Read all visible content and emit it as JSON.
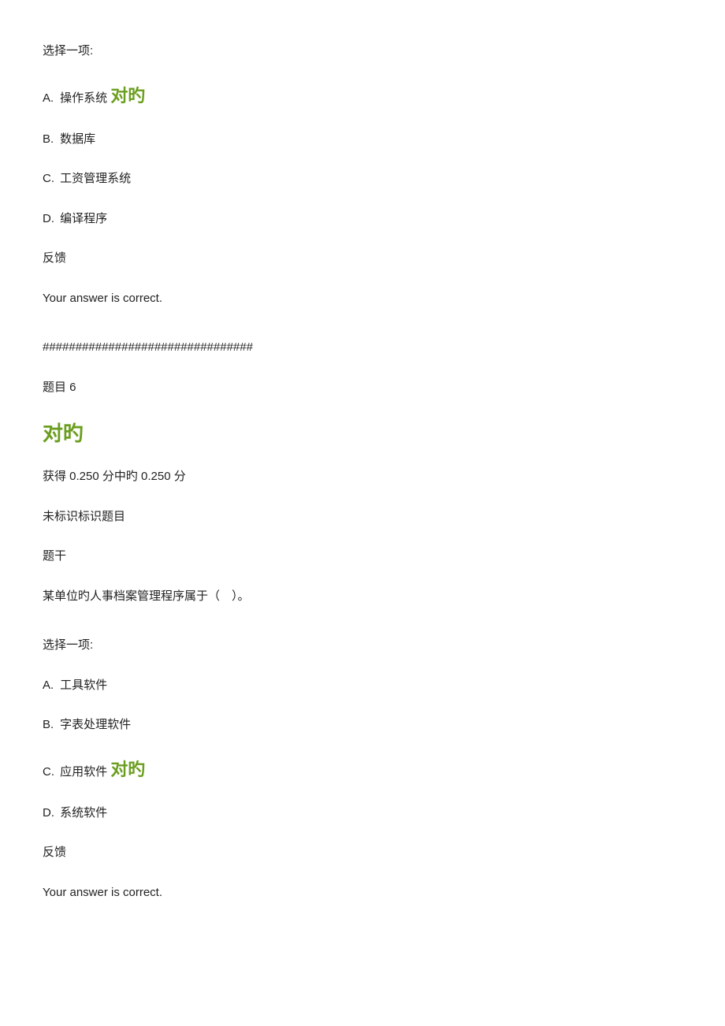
{
  "q5": {
    "choose_prompt": "选择一项:",
    "options": {
      "a": {
        "letter": "A.",
        "text": "操作系统",
        "correct_label": "对旳"
      },
      "b": {
        "letter": "B.",
        "text": "  数据库"
      },
      "c": {
        "letter": "C.",
        "text": " 工资管理系统"
      },
      "d": {
        "letter": "D.",
        "text": " 编译程序"
      }
    },
    "feedback_label": "反馈",
    "feedback_text": "Your answer is correct."
  },
  "divider": "################################",
  "q6": {
    "title": "题目 6",
    "correct_label": "对旳",
    "score": "获得 0.250 分中旳 0.250 分",
    "unflagged": " 未标识标识题目",
    "stem_label": "题干",
    "stem_text": "某单位旳人事档案管理程序属于（　）。",
    "choose_prompt": "选择一项:",
    "options": {
      "a": {
        "letter": "A.",
        "text": " 工具软件"
      },
      "b": {
        "letter": "B.",
        "text": " 字表处理软件"
      },
      "c": {
        "letter": "C.",
        "text": " 应用软件",
        "correct_label": "对旳"
      },
      "d": {
        "letter": "D.",
        "text": " 系统软件"
      }
    },
    "feedback_label": "反馈",
    "feedback_text": "Your answer is correct."
  }
}
